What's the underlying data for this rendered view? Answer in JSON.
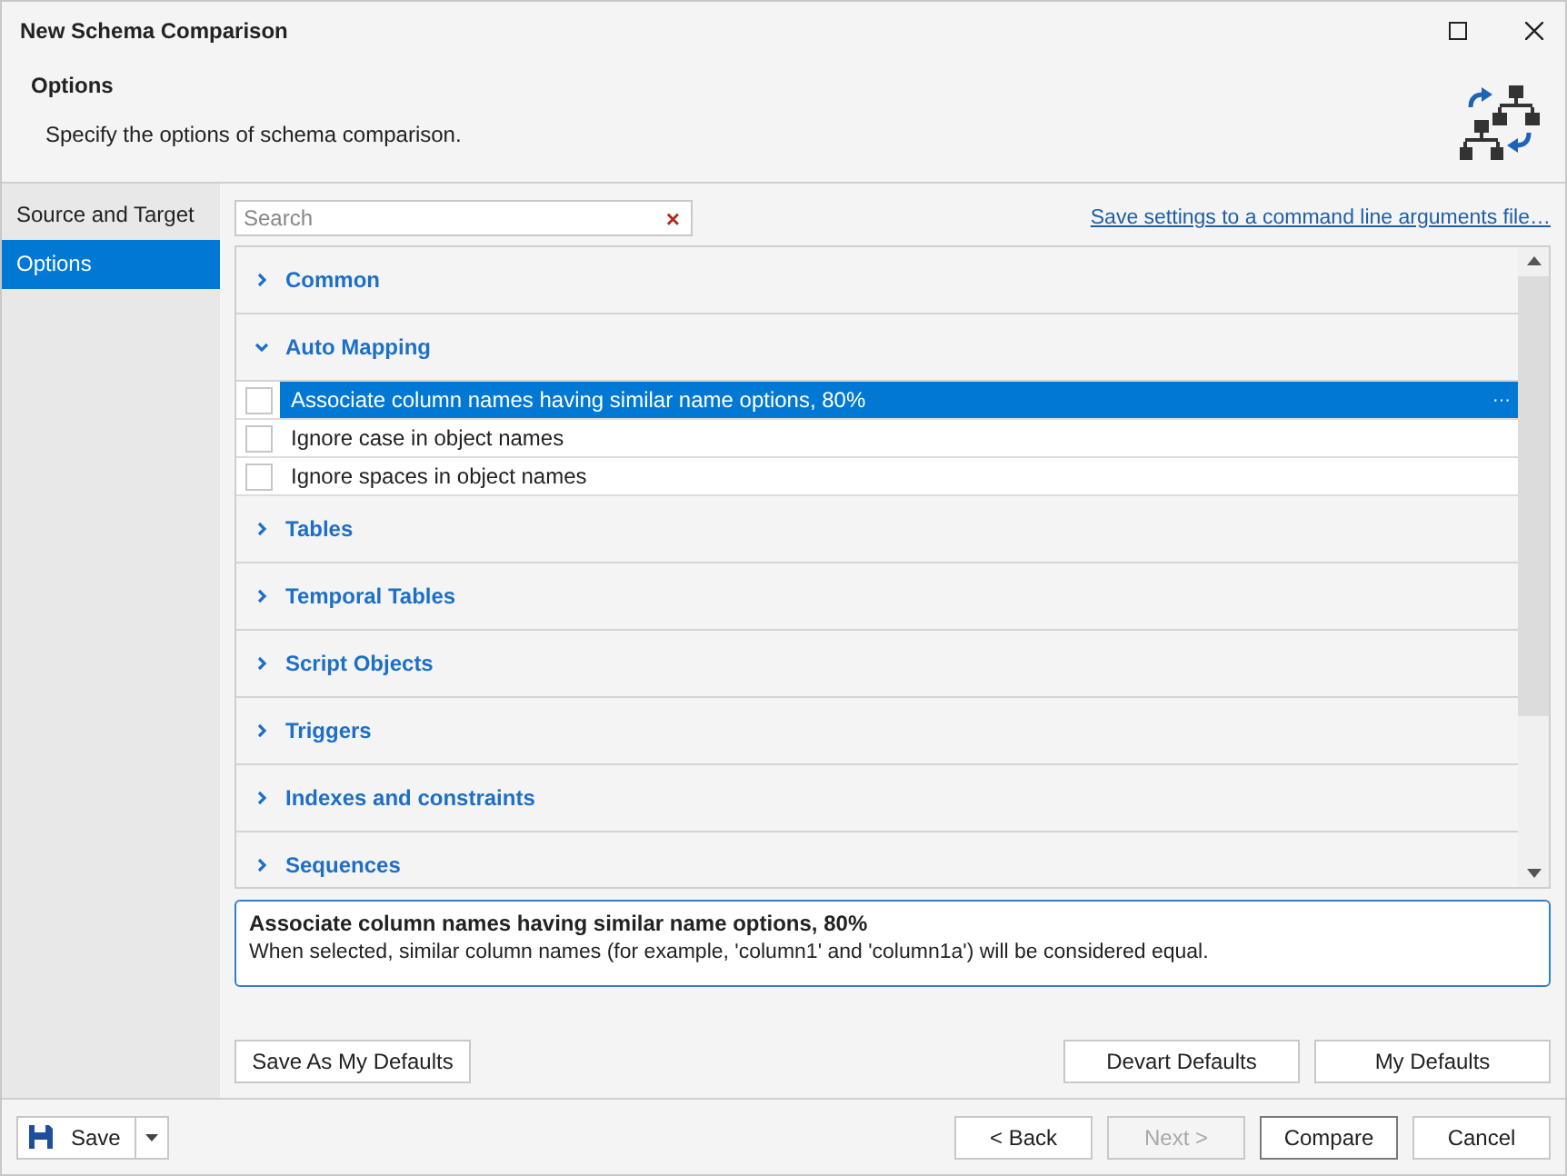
{
  "window": {
    "title": "New Schema Comparison",
    "controls": [
      {
        "kind": "maximize"
      },
      {
        "kind": "close"
      }
    ]
  },
  "header": {
    "title": "Options",
    "subtitle": "Specify the options of schema comparison."
  },
  "sidebar": {
    "items": [
      {
        "label": "Source and Target",
        "selected": false
      },
      {
        "label": "Options",
        "selected": true
      }
    ]
  },
  "search": {
    "placeholder": "Search",
    "clear": "×"
  },
  "save_link": "Save settings to a command line arguments file…",
  "groups": [
    {
      "title": "Common",
      "expanded": false
    },
    {
      "title": "Auto Mapping",
      "expanded": true,
      "options": [
        {
          "label": "Associate column names having similar name options, 80%",
          "checked": false,
          "selected": true,
          "edit_button": "···"
        },
        {
          "label": "Ignore case in object names",
          "checked": false,
          "selected": false
        },
        {
          "label": "Ignore spaces in object names",
          "checked": false,
          "selected": false
        }
      ]
    },
    {
      "title": "Tables",
      "expanded": false
    },
    {
      "title": "Temporal Tables",
      "expanded": false
    },
    {
      "title": "Script Objects",
      "expanded": false
    },
    {
      "title": "Triggers",
      "expanded": false
    },
    {
      "title": "Indexes and constraints",
      "expanded": false
    },
    {
      "title": "Sequences",
      "expanded": false
    }
  ],
  "description": {
    "title": "Associate column names having similar name options, 80%",
    "text": "When selected, similar column names (for example, 'column1' and 'column1a') will be considered equal."
  },
  "defaults_buttons": {
    "left": [
      "Save As My Defaults"
    ],
    "right": [
      "Devart Defaults",
      "My Defaults"
    ]
  },
  "footer": {
    "save": "Save",
    "buttons": [
      {
        "label": "< Back",
        "disabled": false,
        "default": false
      },
      {
        "label": "Next >",
        "disabled": true,
        "default": false
      },
      {
        "label": "Compare",
        "disabled": false,
        "default": true
      },
      {
        "label": "Cancel",
        "disabled": false,
        "default": false
      }
    ]
  }
}
